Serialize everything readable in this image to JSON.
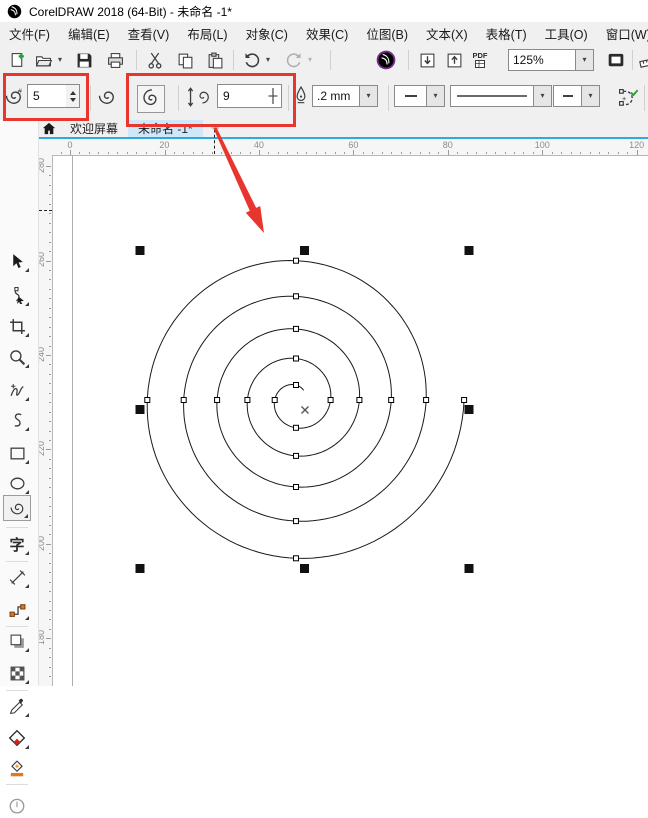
{
  "window": {
    "title": "CorelDRAW 2018 (64-Bit) - 未命名 -1*"
  },
  "menu": {
    "items": [
      "文件(F)",
      "编辑(E)",
      "查看(V)",
      "布局(L)",
      "对象(C)",
      "效果(C)",
      "位图(B)",
      "文本(X)",
      "表格(T)",
      "工具(O)",
      "窗口(W)"
    ]
  },
  "toolbar": {
    "zoom_value": "125%",
    "pdf_label": "PDF"
  },
  "property_bar": {
    "revolutions_value": "5",
    "expansion_value": "9",
    "outline_width_value": ".2 mm"
  },
  "tabs": {
    "welcome_label": "欢迎屏幕",
    "document_label": "未命名 -1*",
    "new_tab_label": "+"
  },
  "toolbox": {
    "text_tool_label": "字"
  },
  "rulers": {
    "horizontal_labels": [
      "0",
      "20",
      "40",
      "60",
      "80",
      "100",
      "120"
    ],
    "vertical_labels": [
      "280",
      "260",
      "240",
      "220",
      "200",
      "180"
    ]
  },
  "drawing": {
    "spiral": {
      "revolutions": 5,
      "expansion_factor": 9,
      "node_count": 20
    }
  },
  "annotations": {
    "highlight_color": "#e8352e"
  }
}
